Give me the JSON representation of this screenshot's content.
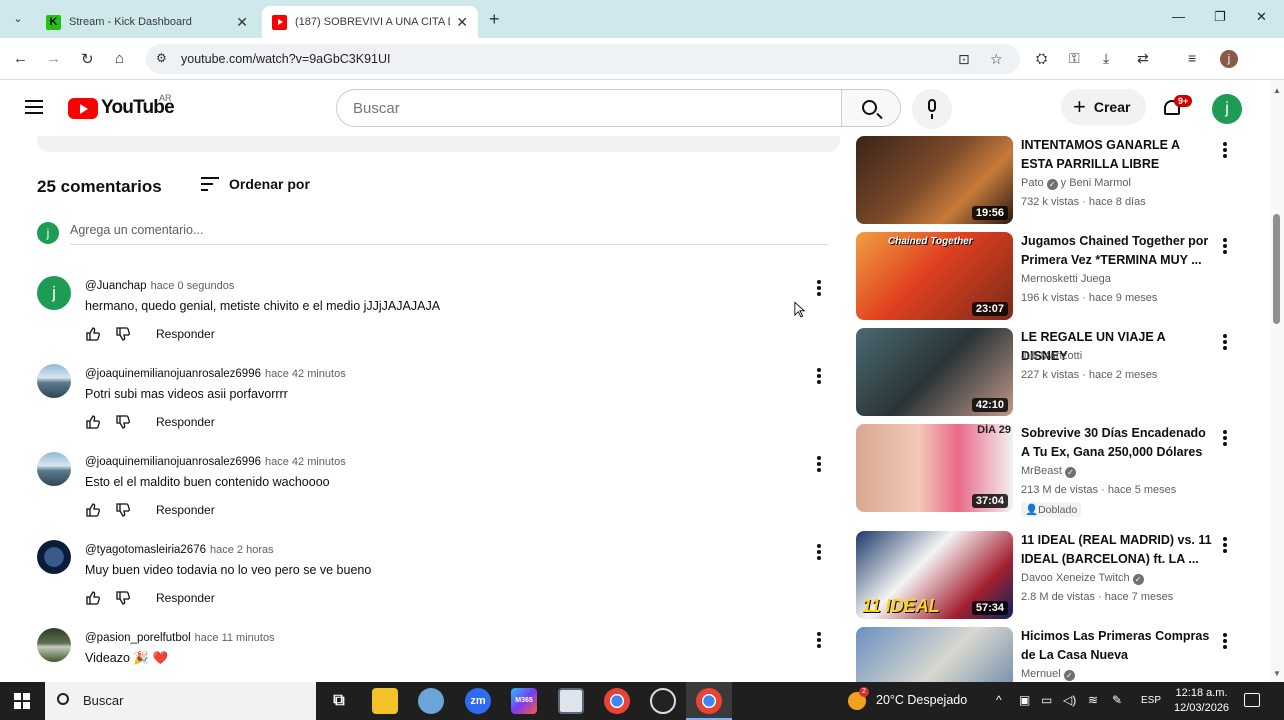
{
  "browser": {
    "tabs": [
      {
        "title": "Stream - Kick Dashboard",
        "favicon": "kick-icon",
        "active": false
      },
      {
        "title": "(187) SOBREVIVI A UNA CITA D",
        "favicon": "youtube-icon",
        "active": true
      }
    ],
    "url": "youtube.com/watch?v=9aGbC3K91UI",
    "kick_letter": "K",
    "profile_initial": "j"
  },
  "header": {
    "logo_text": "YouTube",
    "country": "AR",
    "search_placeholder": "Buscar",
    "create_label": "Crear",
    "notifications_badge": "9+",
    "avatar_initial": "j"
  },
  "comments": {
    "count_label": "25 comentarios",
    "sort_label": "Ordenar por",
    "add_placeholder": "Agrega un comentario...",
    "reply_label": "Responder",
    "items": [
      {
        "author": "@Juanchap",
        "time": "hace 0 segundos",
        "text": "hermano, quedo genial, metiste chivito e el medio jJJjJAJAJAJA",
        "avatar_initial": "j"
      },
      {
        "author": "@joaquinemilianojuanrosalez6996",
        "time": "hace 42 minutos",
        "text": "Potri subi mas videos asii porfavorrrr",
        "avatar_initial": ""
      },
      {
        "author": "@joaquinemilianojuanrosalez6996",
        "time": "hace 42 minutos",
        "text": "Esto el el maldito buen contenido wachoooo",
        "avatar_initial": ""
      },
      {
        "author": "@tyagotomasleiria2676",
        "time": "hace 2 horas",
        "text": "Muy buen video todavia no lo veo pero se ve bueno",
        "avatar_initial": ""
      },
      {
        "author": "@pasion_porelfutbol",
        "time": "hace 11 minutos",
        "text": "Videazo 🎉 ❤️",
        "avatar_initial": ""
      }
    ]
  },
  "sidebar": {
    "items": [
      {
        "title": "INTENTAMOS GANARLE A ESTA PARRILLA LIBRE",
        "channel": "Pato",
        "channel_suffix": "y Beni Marmol",
        "verified": true,
        "meta": "732 k vistas · hace 8 días",
        "duration": "19:56",
        "badge": ""
      },
      {
        "title": "Jugamos Chained Together por Primera Vez *TERMINA MUY ...",
        "channel": "Mernosketti Juega",
        "channel_suffix": "",
        "verified": false,
        "meta": "196 k vistas · hace 9 meses",
        "duration": "23:07",
        "badge": "",
        "thumb_text": "Chained Together"
      },
      {
        "title": "LE REGALE UN VIAJE A DISNEY",
        "channel": "Juli Manzotti",
        "channel_suffix": "",
        "verified": false,
        "meta": "227 k vistas · hace 2 meses",
        "duration": "42:10",
        "badge": ""
      },
      {
        "title": "Sobrevive 30 Días Encadenado A Tu Ex, Gana 250,000 Dólares",
        "channel": "MrBeast",
        "channel_suffix": "",
        "verified": true,
        "meta": "213 M de vistas · hace 5 meses",
        "duration": "37:04",
        "badge": "Doblado",
        "thumb_text": "DÍA 29"
      },
      {
        "title": "11 IDEAL (REAL MADRID) vs. 11 IDEAL (BARCELONA) ft. LA ...",
        "channel": "Davoo Xeneize Twitch",
        "channel_suffix": "",
        "verified": true,
        "meta": "2.8 M de vistas · hace 7 meses",
        "duration": "57:34",
        "badge": "",
        "thumb_text": "11 IDEAL"
      },
      {
        "title": "Hicimos Las Primeras Compras de La Casa Nueva",
        "channel": "Mernuel",
        "channel_suffix": "",
        "verified": true,
        "meta": "",
        "duration": "",
        "badge": ""
      }
    ]
  },
  "taskbar": {
    "search_label": "Buscar",
    "weather": "20°C  Despejado",
    "weather_badge": "2",
    "language": "ESP",
    "time": "12:18 a.m.",
    "date": "12/03/2026",
    "zoom_label": "zm",
    "app_label": "M365"
  }
}
